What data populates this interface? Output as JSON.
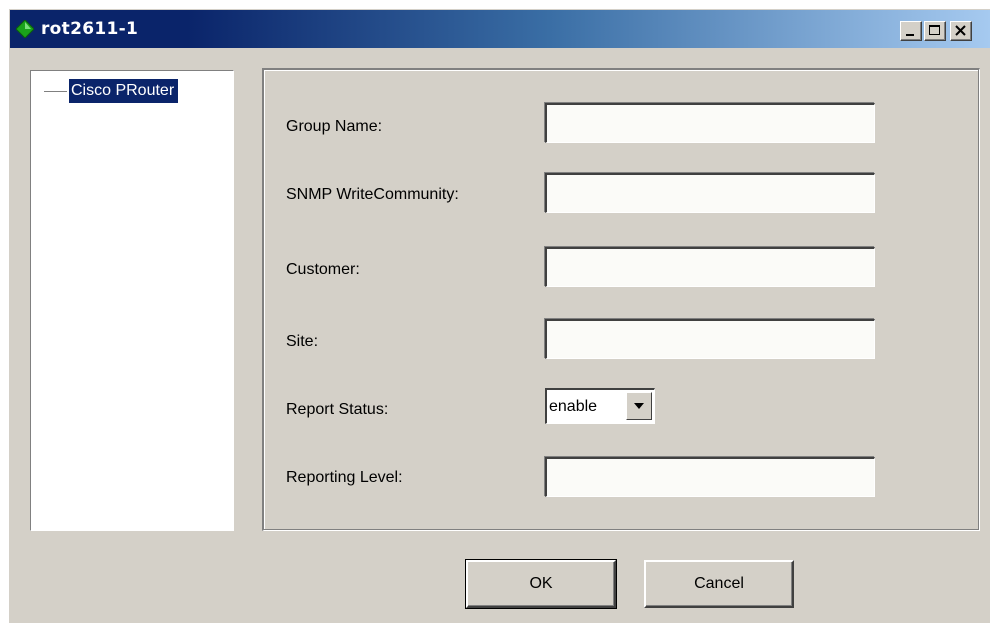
{
  "window": {
    "title": "rot2611-1",
    "controls": {
      "minimize": "minimize-icon",
      "maximize": "maximize-icon",
      "close": "close-icon"
    }
  },
  "tree": {
    "nodes": [
      {
        "label": "Cisco PRouter",
        "selected": true
      }
    ]
  },
  "form": {
    "fields": [
      {
        "label": "Group Name:",
        "value": ""
      },
      {
        "label": "SNMP WriteCommunity:",
        "value": ""
      },
      {
        "label": "Customer:",
        "value": ""
      },
      {
        "label": "Site:",
        "value": ""
      },
      {
        "label": "Report Status:",
        "value": "enable"
      },
      {
        "label": "Reporting Level:",
        "value": ""
      }
    ]
  },
  "buttons": {
    "ok": "OK",
    "cancel": "Cancel"
  },
  "colors": {
    "titlebar_start": "#0a246a",
    "titlebar_end": "#a6caf0",
    "window_bg": "#d4d0c8",
    "selection": "#0a246a",
    "app_icon": "#1aa31a"
  }
}
